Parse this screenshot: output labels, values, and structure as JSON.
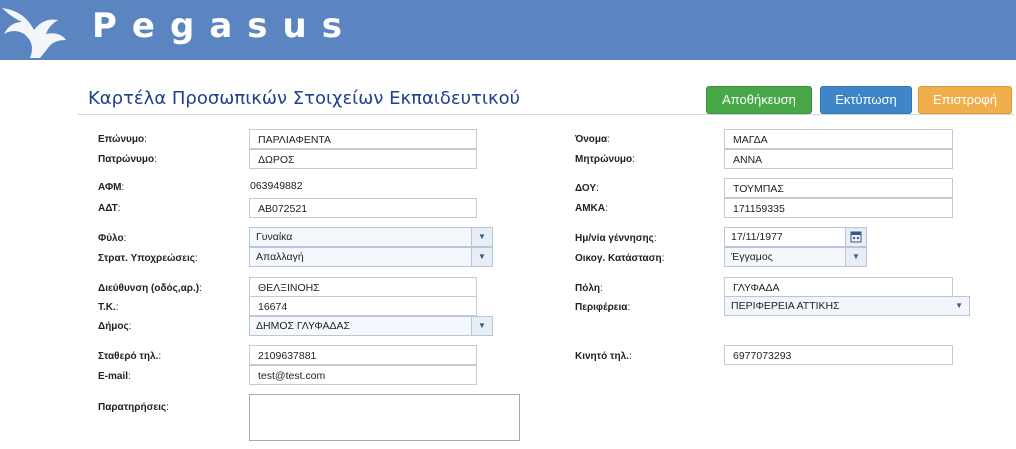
{
  "header": {
    "brand": "Pegasus"
  },
  "page": {
    "title": "Καρτέλα Προσωπικών Στοιχείων Εκπαιδευτικού"
  },
  "buttons": {
    "save": "Αποθήκευση",
    "print": "Εκτύπωση",
    "back": "Επιστροφή"
  },
  "colors": {
    "header": "#5b85c1",
    "save": "#48a848",
    "print": "#3f86c8",
    "back": "#f0ae4c",
    "title": "#1f3f8f"
  },
  "form": {
    "surname": {
      "label": "Επώνυμο",
      "value": "ΠΑΡΛΙΑΦΕΝΤΑ"
    },
    "name": {
      "label": "Όνομα",
      "value": "ΜΑΓΔΑ"
    },
    "father": {
      "label": "Πατρώνυμο",
      "value": "ΔΩΡΟΣ"
    },
    "mother": {
      "label": "Μητρώνυμο",
      "value": "ΑΝΝΑ"
    },
    "afm": {
      "label": "ΑΦΜ",
      "value": "063949882"
    },
    "doy": {
      "label": "ΔΟΥ",
      "value": "ΤΟΥΜΠΑΣ"
    },
    "adt": {
      "label": "ΑΔΤ",
      "value": "ΑΒ072521"
    },
    "amka": {
      "label": "ΑΜΚΑ",
      "value": "171159335"
    },
    "gender": {
      "label": "Φύλο",
      "value": "Γυναίκα"
    },
    "birth": {
      "label": "Ημ/νία γέννησης",
      "value": "17/11/1977"
    },
    "military": {
      "label": "Στρατ. Υποχρεώσεις",
      "value": "Απαλλαγή"
    },
    "marital": {
      "label": "Οικογ. Κατάσταση",
      "value": "Έγγαμος"
    },
    "address": {
      "label": "Διεύθυνση (οδός,αρ.)",
      "value": "ΘΕΛΞΙΝΟΗΣ"
    },
    "city": {
      "label": "Πόλη",
      "value": "ΓΛΥΦΑΔΑ"
    },
    "zip": {
      "label": "Τ.Κ.",
      "value": "16674"
    },
    "region": {
      "label": "Περιφέρεια",
      "value": "ΠΕΡΙΦΕΡΕΙΑ ΑΤΤΙΚΗΣ"
    },
    "municipality": {
      "label": "Δήμος",
      "value": "ΔΗΜΟΣ ΓΛΥΦΑΔΑΣ"
    },
    "phone": {
      "label": "Σταθερό τηλ.",
      "value": "2109637881"
    },
    "mobile": {
      "label": "Κινητό τηλ.",
      "value": "6977073293"
    },
    "email": {
      "label": "E-mail",
      "value": "test@test.com"
    },
    "notes": {
      "label": "Παρατηρήσεις",
      "value": ""
    }
  }
}
